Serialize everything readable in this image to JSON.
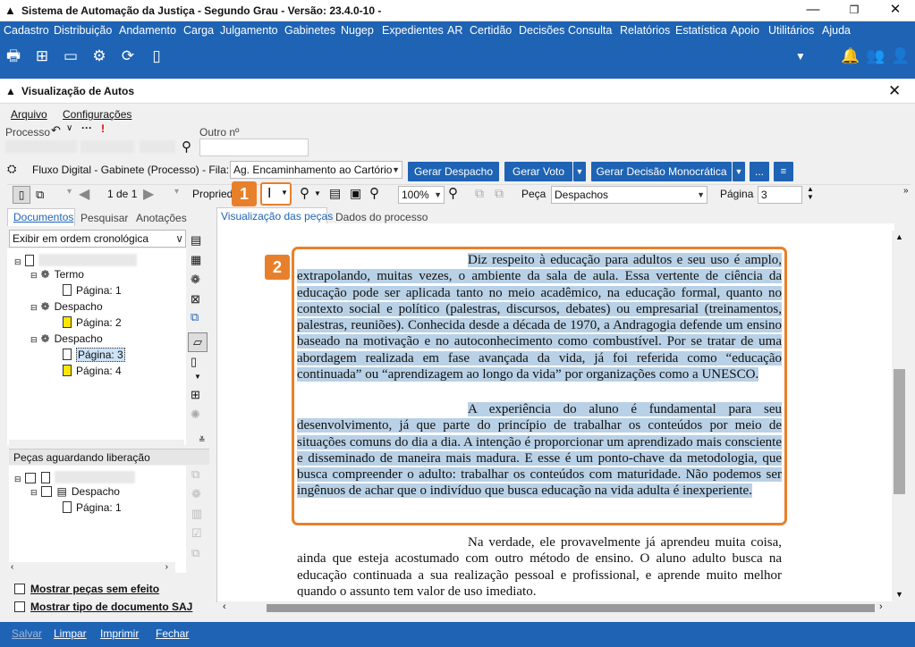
{
  "window": {
    "title": "Sistema de Automação da Justiça - Segundo Grau - Versão: 23.4.0-10 -"
  },
  "menu": [
    "Cadastro",
    "Distribuição",
    "Andamento",
    "Carga",
    "Julgamento",
    "Gabinetes",
    "Nugep",
    "Expedientes",
    "AR",
    "Certidão",
    "Decisões",
    "Consulta",
    "Relatórios",
    "Estatística",
    "Apoio",
    "Utilitários",
    "Ajuda"
  ],
  "subwindow": {
    "title": "Visualização de Autos"
  },
  "submenu": {
    "arquivo": "Arquivo",
    "config": "Configurações"
  },
  "processo": {
    "label": "Processo",
    "outro_label": "Outro nº"
  },
  "fluxo": {
    "text": "Fluxo Digital - Gabinete (Processo) - Fila:",
    "fila_value": "Ag. Encaminhamento ao Cartório"
  },
  "buttons": {
    "despacho": "Gerar Despacho",
    "voto": "Gerar Voto",
    "decisao": "Gerar Decisão Monocrática",
    "more": "..."
  },
  "viewer_toolbar": {
    "pages": "1 de 1",
    "propriedades": "Propried",
    "zoom": "100%",
    "peca_label": "Peça",
    "peca_value": "Despachos",
    "pagina_label": "Página",
    "pagina_value": "3"
  },
  "left_tabs": {
    "documentos": "Documentos",
    "pesquisar": "Pesquisar",
    "anotacoes": "Anotações"
  },
  "order": "Exibir em ordem cronológica",
  "tree": {
    "termo": "Termo",
    "p1": "Página: 1",
    "despacho1": "Despacho",
    "p2": "Página: 2",
    "despacho2": "Despacho",
    "p3": "Página: 3",
    "p4": "Página: 4"
  },
  "pending": {
    "title": "Peças aguardando liberação",
    "despacho": "Despacho",
    "p1": "Página: 1"
  },
  "checks": {
    "sem_efeito": "Mostrar peças sem efeito",
    "tipo_doc": "Mostrar tipo de documento SAJ"
  },
  "viewer_tabs": {
    "pecas": "Visualização das peças",
    "dados": "Dados do processo"
  },
  "badges": {
    "one": "1",
    "two": "2"
  },
  "text": {
    "p1_hl": "Diz respeito à educação para adultos e seu uso é amplo, extrapolando, muitas vezes, o ambiente da sala de aula. Essa vertente de ciência da educação pode ser aplicada tanto no meio acadêmico, na educação formal, quanto no contexto social e político (palestras, discursos, debates) ou empresarial (treinamentos, palestras, reuniões). Conhecida desde a década de 1970, a Andragogia defende um ensino baseado na motivação e no autoconhecimento como combustível. Por se tratar de uma abordagem realizada em fase avançada da vida, já foi referida como “educação continuada” ou “aprendizagem ao longo da vida” por organizações como a UNESCO.",
    "p2_hl": "A experiência do aluno é fundamental para seu desenvolvimento, já que parte do princípio de trabalhar os conteúdos por meio de situações comuns do dia a dia. A intenção é proporcionar um aprendizado mais consciente e disseminado de maneira mais madura. E esse é um ponto-chave da metodologia, que busca compreender o adulto: trabalhar os conteúdos com maturidade. Não podemos ser ingênuos de achar que o indivíduo que busca educação na vida adulta é inexperiente.",
    "p3": "Na verdade, ele provavelmente já aprendeu muita coisa, ainda que esteja acostumado com outro método de ensino. O aluno adulto busca na educação continuada a sua realização pessoal e profissional, e aprende muito melhor quando o assunto tem valor de uso imediato."
  },
  "footer": {
    "salvar": "Salvar",
    "limpar": "Limpar",
    "imprimir": "Imprimir",
    "fechar": "Fechar"
  },
  "colors": {
    "brand": "#1e63b4",
    "highlight": "#b9d1e6",
    "callout": "#e8802b"
  }
}
